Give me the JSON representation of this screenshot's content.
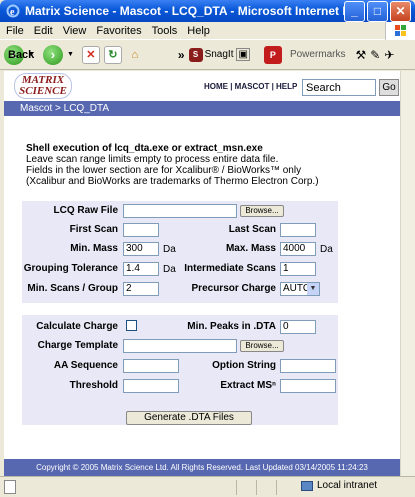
{
  "window": {
    "title": "Matrix Science - Mascot - LCQ_DTA - Microsoft Internet Explorer",
    "minimize": "_",
    "maximize": "□",
    "close": "✕"
  },
  "menu": [
    "File",
    "Edit",
    "View",
    "Favorites",
    "Tools",
    "Help"
  ],
  "toolbar": {
    "back_label": "Back",
    "snagit_label": "SnagIt",
    "powermarks_label": "Powermarks",
    "chevron": "»"
  },
  "header": {
    "logo_line1": "MATRIX",
    "logo_line2": "SCIENCE",
    "nav": "HOME | MASCOT | HELP",
    "search_value": "Search",
    "go_label": "Go"
  },
  "breadcrumb": "Mascot > LCQ_DTA",
  "intro": {
    "title": "Shell execution of lcq_dta.exe or extract_msn.exe",
    "line1": "Leave scan range limits empty to process entire data file.",
    "line2": "Fields in the lower section are for Xcalibur® / BioWorks™ only",
    "line3": "(Xcalibur and BioWorks are trademarks of Thermo Electron Corp.)"
  },
  "form1": {
    "raw_file_label": "LCQ Raw File",
    "raw_file_value": "",
    "browse_label": "Browse...",
    "first_scan_label": "First Scan",
    "first_scan_value": "",
    "last_scan_label": "Last Scan",
    "last_scan_value": "",
    "min_mass_label": "Min. Mass",
    "min_mass_value": "300",
    "min_mass_unit": "Da",
    "max_mass_label": "Max. Mass",
    "max_mass_value": "4000",
    "max_mass_unit": "Da",
    "grouping_label": "Grouping Tolerance",
    "grouping_value": "1.4",
    "grouping_unit": "Da",
    "intermediate_label": "Intermediate Scans",
    "intermediate_value": "1",
    "min_scans_label": "Min. Scans / Group",
    "min_scans_value": "2",
    "precursor_label": "Precursor Charge",
    "precursor_value": "AUTO"
  },
  "form2": {
    "calc_charge_label": "Calculate Charge",
    "min_peaks_label": "Min. Peaks in .DTA",
    "min_peaks_value": "0",
    "charge_template_label": "Charge Template",
    "charge_template_value": "",
    "browse_label": "Browse...",
    "aa_sequence_label": "AA Sequence",
    "aa_sequence_value": "",
    "option_string_label": "Option String",
    "option_string_value": "",
    "threshold_label": "Threshold",
    "threshold_value": "",
    "extract_label": "Extract MSⁿ",
    "extract_value": "",
    "generate_label": "Generate .DTA Files"
  },
  "footer": "Copyright © 2005 Matrix Science Ltd. All Rights Reserved. Last Updated 03/14/2005 11:24:23",
  "status": {
    "zone_label": "Local intranet"
  }
}
